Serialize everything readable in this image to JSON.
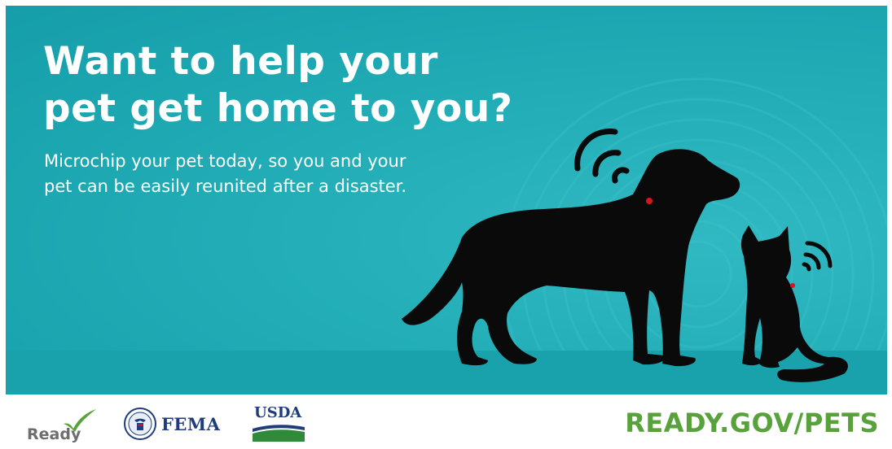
{
  "banner": {
    "headline_line1": "Want to help your",
    "headline_line2": "pet get home to you?",
    "subtext_line1": "Microchip your pet today, so you and your",
    "subtext_line2": "pet can be easily reunited after a disaster."
  },
  "footer": {
    "ready_logo_text": "Ready",
    "fema_logo_text": "FEMA",
    "usda_logo_text": "USDA",
    "url": "READY.GOV/PETS"
  },
  "colors": {
    "background_teal": "#22adb7",
    "silhouette": "#0a0a0a",
    "microchip_red": "#d8141c",
    "url_green": "#58a23b",
    "agency_blue": "#1f3d7a"
  }
}
